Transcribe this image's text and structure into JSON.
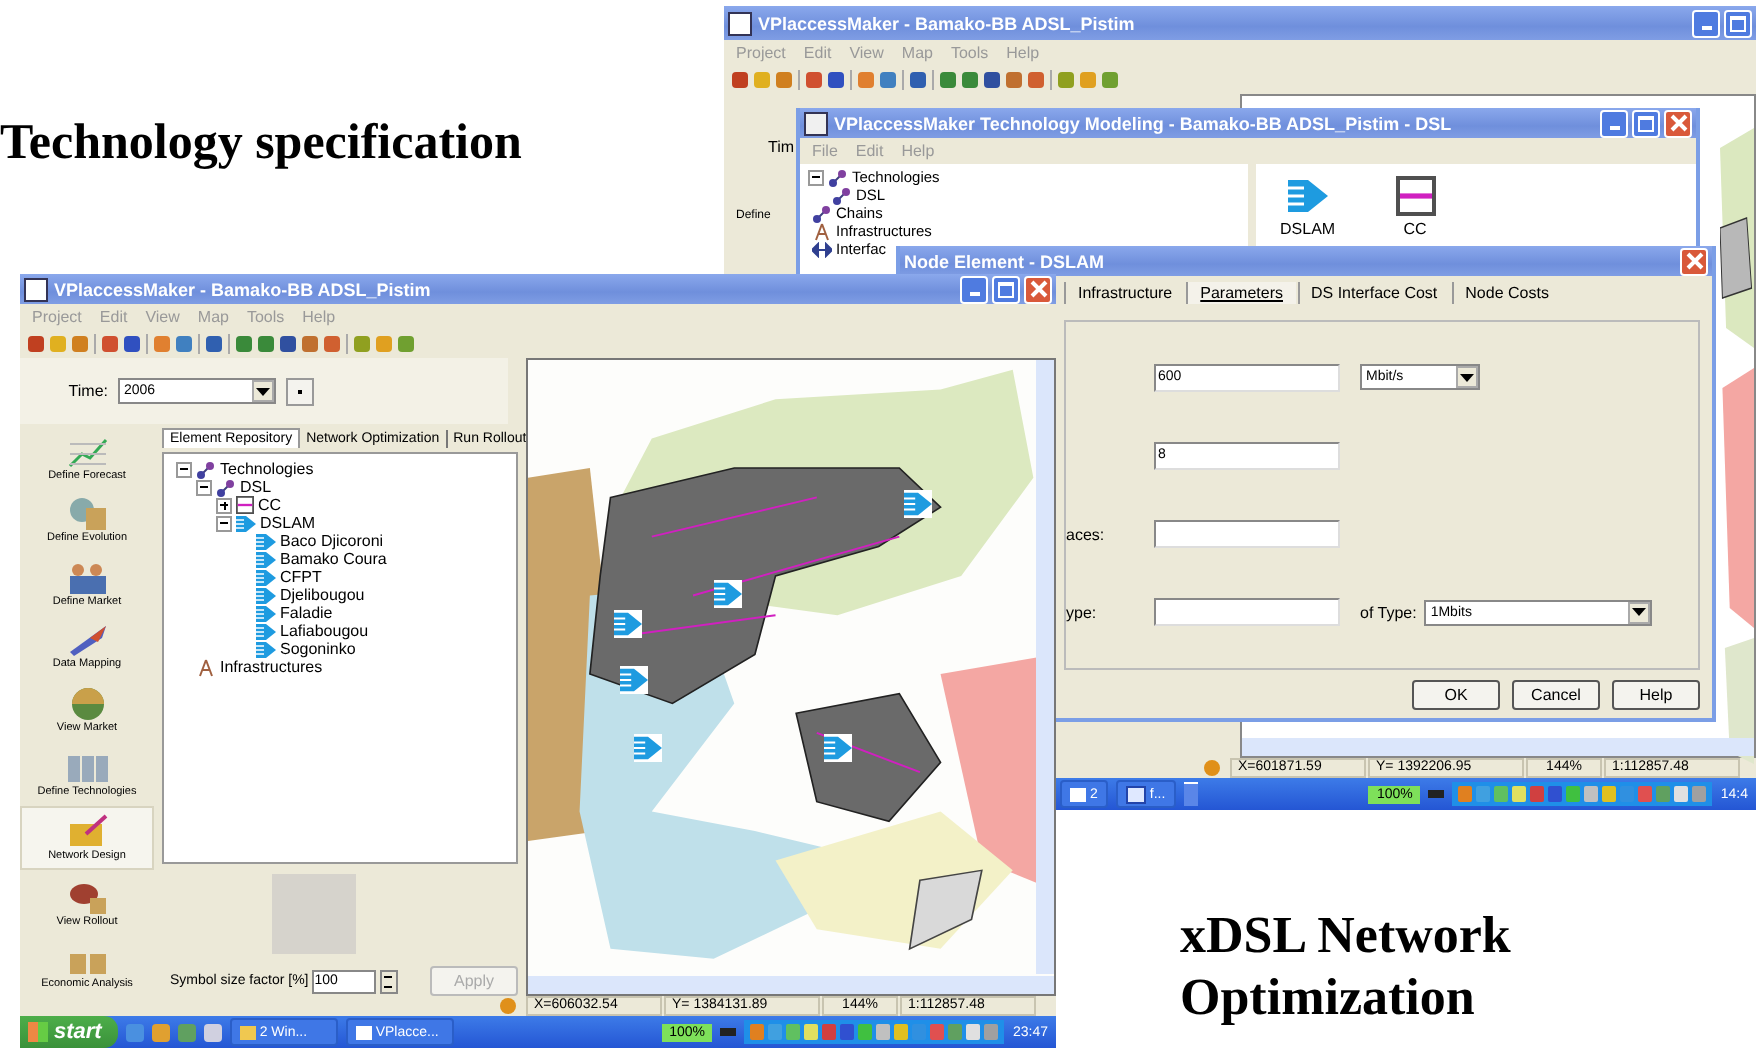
{
  "slide": {
    "heading_1": "Technology specification",
    "heading_2": "xDSL Network Optimization"
  },
  "back_window": {
    "title": "VPlaccessMaker - Bamako-BB ADSL_Pistim",
    "menu": [
      "Project",
      "Edit",
      "View",
      "Map",
      "Tools",
      "Help"
    ],
    "time_label": "Tim",
    "tool_label": "Define",
    "status_bar": [
      "X=601871.59",
      "Y= 1392206.95",
      "144%",
      "1:112857.48"
    ],
    "taskbar": {
      "buttons": [
        {
          "label": "2",
          "kind": "app"
        },
        {
          "label": "f...",
          "kind": "doc"
        }
      ],
      "zoom": "100%",
      "clock": "14:4"
    }
  },
  "tech_window": {
    "title": "VPlaccessMaker Technology Modeling - Bamako-BB ADSL_Pistim - DSL",
    "menu": [
      "File",
      "Edit",
      "Help"
    ],
    "tree": [
      {
        "label": "Technologies",
        "kind": "tech",
        "expanded": true,
        "children": [
          {
            "label": "DSL",
            "kind": "tech"
          }
        ]
      },
      {
        "label": "Chains",
        "kind": "tech"
      },
      {
        "label": "Infrastructures",
        "kind": "infra"
      },
      {
        "label": "Interfac",
        "kind": "iface"
      }
    ],
    "elements": [
      {
        "label": "DSLAM",
        "kind": "dslam"
      },
      {
        "label": "CC",
        "kind": "box"
      }
    ]
  },
  "node_dialog": {
    "title": "Node Element - DSLAM",
    "tabs": [
      {
        "label": "Infrastructure",
        "selected": false
      },
      {
        "label": "Parameters",
        "selected": true
      },
      {
        "label": "DS Interface Cost",
        "selected": false
      },
      {
        "label": "Node Costs",
        "selected": false
      }
    ],
    "rows": [
      {
        "value": "600",
        "unit": "Mbit/s"
      },
      {
        "value": "8"
      },
      {
        "label": "aces:"
      },
      {
        "label": "ype:",
        "extra_label": "of Type:",
        "choice": "1Mbits"
      }
    ],
    "buttons": [
      "OK",
      "Cancel",
      "Help"
    ]
  },
  "front_window": {
    "title": "VPlaccessMaker - Bamako-BB ADSL_Pistim",
    "menu": [
      "Project",
      "Edit",
      "View",
      "Map",
      "Tools",
      "Help"
    ],
    "time": {
      "label": "Time:",
      "value": "2006"
    },
    "tools": [
      {
        "label": "Define Forecast",
        "selected": false
      },
      {
        "label": "Define Evolution",
        "selected": false
      },
      {
        "label": "Define Market",
        "selected": false
      },
      {
        "label": "Data Mapping",
        "selected": false
      },
      {
        "label": "View Market",
        "selected": false
      },
      {
        "label": "Define Technologies",
        "selected": false
      },
      {
        "label": "Network Design",
        "selected": true
      },
      {
        "label": "View Rollout",
        "selected": false
      },
      {
        "label": "Economic Analysis",
        "selected": false
      }
    ],
    "tabs": [
      {
        "label": "Element Repository",
        "selected": true
      },
      {
        "label": "Network Optimization",
        "selected": false
      },
      {
        "label": "Run Rollout",
        "selected": false
      }
    ],
    "tree": [
      {
        "label": "Technologies",
        "kind": "tech",
        "expanded": true,
        "children": [
          {
            "label": "DSL",
            "kind": "tech",
            "expanded": true,
            "children": [
              {
                "label": "CC",
                "kind": "box",
                "expanded": false
              },
              {
                "label": "DSLAM",
                "kind": "dslam",
                "expanded": true,
                "children": [
                  {
                    "label": "Baco Djicoroni",
                    "kind": "dslam"
                  },
                  {
                    "label": "Bamako Coura",
                    "kind": "dslam"
                  },
                  {
                    "label": "CFPT",
                    "kind": "dslam"
                  },
                  {
                    "label": "Djelibougou",
                    "kind": "dslam"
                  },
                  {
                    "label": "Faladie",
                    "kind": "dslam"
                  },
                  {
                    "label": "Lafiabougou",
                    "kind": "dslam"
                  },
                  {
                    "label": "Sogoninko",
                    "kind": "dslam"
                  }
                ]
              }
            ]
          }
        ]
      },
      {
        "label": "Infrastructures",
        "kind": "infra"
      }
    ],
    "symbol_size": {
      "label": "Symbol size factor [%]",
      "value": "100"
    },
    "apply": {
      "label": "Apply",
      "disabled": true
    },
    "status_bar": [
      "X=606032.54",
      "Y= 1384131.89",
      "144%",
      "1:112857.48"
    ],
    "taskbar": {
      "start": "start",
      "buttons": [
        {
          "label": "2 Win...",
          "kind": "folder"
        },
        {
          "label": "VPlacce...",
          "kind": "app"
        }
      ],
      "zoom": "100%",
      "clock": "23:47"
    }
  }
}
